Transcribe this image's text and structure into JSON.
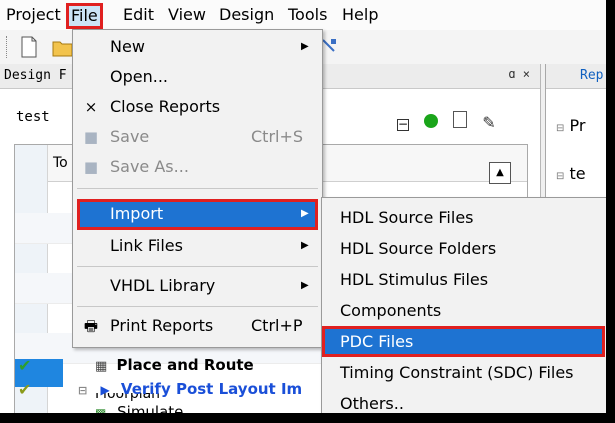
{
  "menubar": {
    "items": [
      {
        "label": "Project"
      },
      {
        "label": "File"
      },
      {
        "label": "Edit"
      },
      {
        "label": "View"
      },
      {
        "label": "Design"
      },
      {
        "label": "Tools"
      },
      {
        "label": "Help"
      }
    ]
  },
  "left_panel": {
    "title": "Design F",
    "controls": "ɑ ×",
    "project_name": "test",
    "column_header": "To",
    "rows": [
      {
        "label": "Floorplan"
      },
      {
        "label": "Place and Route"
      },
      {
        "label": "Verify Post Layout Im"
      },
      {
        "label": "Simulate"
      }
    ]
  },
  "right_panel": {
    "title": "Rep",
    "tree": [
      {
        "label": "Pr"
      },
      {
        "label": "te"
      }
    ]
  },
  "file_menu": {
    "items": [
      {
        "label": "New",
        "submenu": true
      },
      {
        "label": "Open..."
      },
      {
        "label": "Close Reports"
      },
      {
        "label": "Save",
        "shortcut": "Ctrl+S",
        "disabled": true
      },
      {
        "label": "Save As...",
        "disabled": true
      },
      {
        "label": "Import",
        "submenu": true,
        "selected": true
      },
      {
        "label": "Link Files",
        "submenu": true
      },
      {
        "label": "VHDL Library",
        "submenu": true
      },
      {
        "label": "Print Reports",
        "shortcut": "Ctrl+P"
      }
    ]
  },
  "import_submenu": {
    "items": [
      {
        "label": "HDL Source Files"
      },
      {
        "label": "HDL Source Folders"
      },
      {
        "label": "HDL Stimulus Files"
      },
      {
        "label": "Components"
      },
      {
        "label": "PDC Files",
        "selected": true
      },
      {
        "label": "Timing Constraint (SDC) Files"
      },
      {
        "label": "Others.."
      }
    ]
  },
  "colors": {
    "highlight_border": "#e02020",
    "selection": "#1e73d2",
    "link_blue": "#1a4fd8"
  }
}
